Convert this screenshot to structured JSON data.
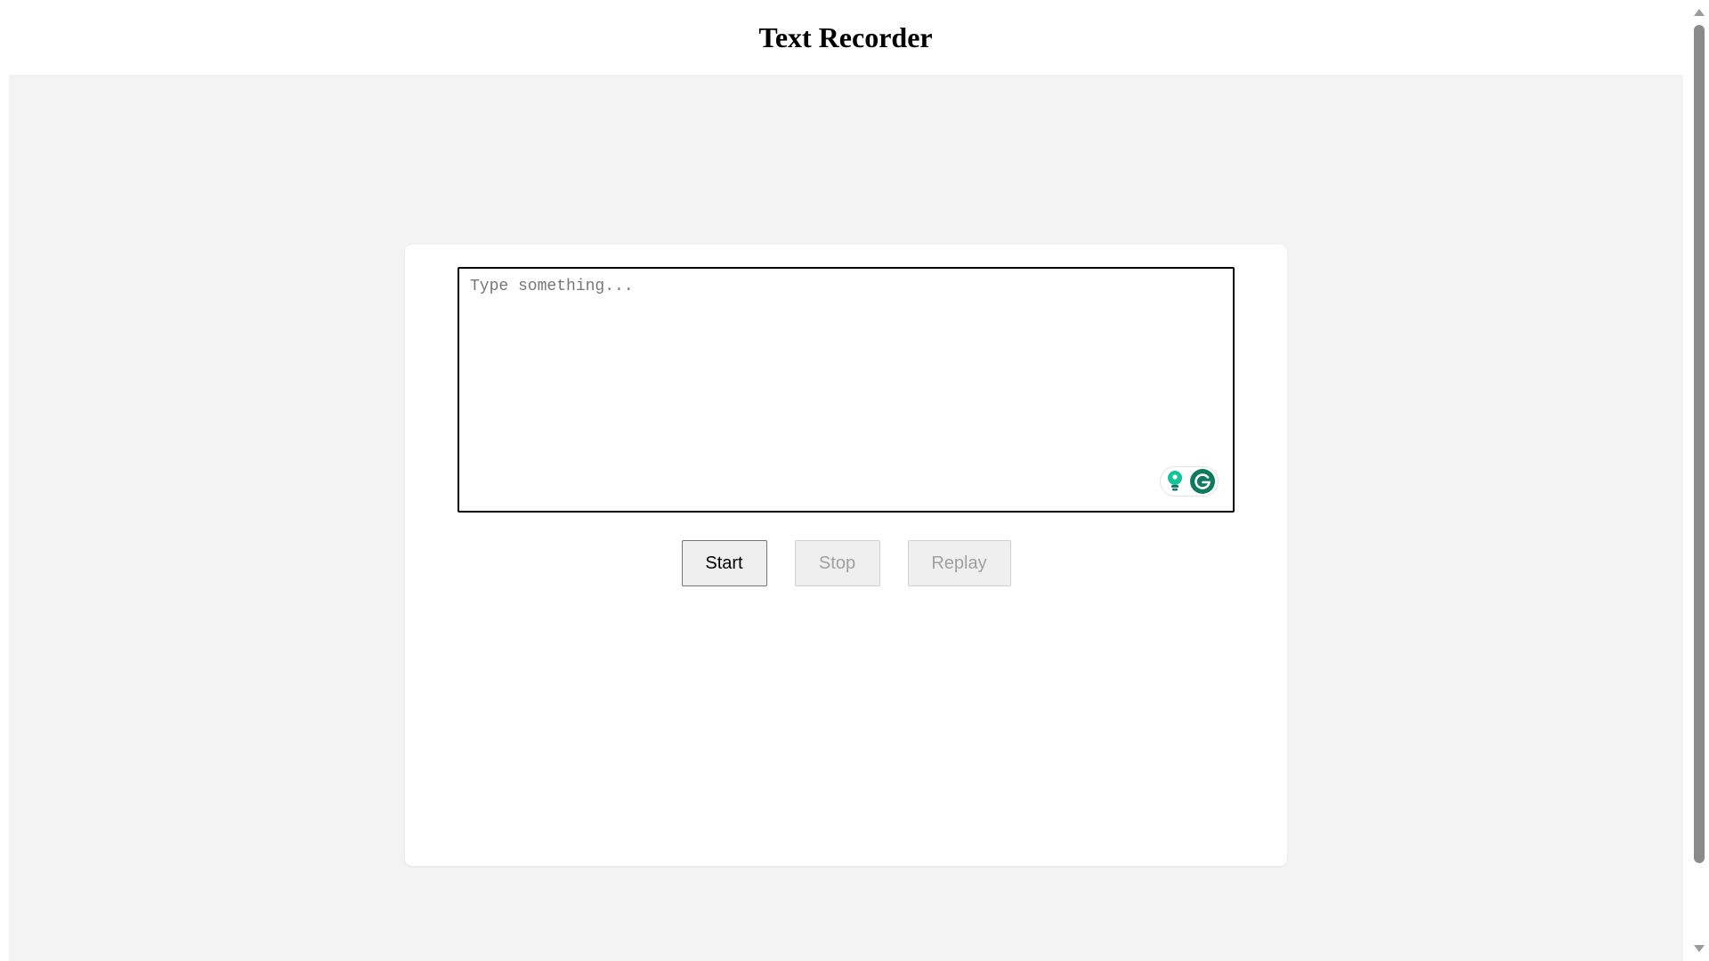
{
  "page": {
    "title": "Text Recorder"
  },
  "editor": {
    "placeholder": "Type something...",
    "value": ""
  },
  "controls": {
    "start_label": "Start",
    "stop_label": "Stop",
    "replay_label": "Replay"
  },
  "extension_widget": {
    "bulb_icon": "lightbulb-icon",
    "grammarly_icon": "grammarly-g-icon"
  },
  "colors": {
    "background": "#f3f3f3",
    "card": "#ffffff",
    "grammarly_green": "#15c39a",
    "grammarly_dark": "#0f7a60"
  }
}
